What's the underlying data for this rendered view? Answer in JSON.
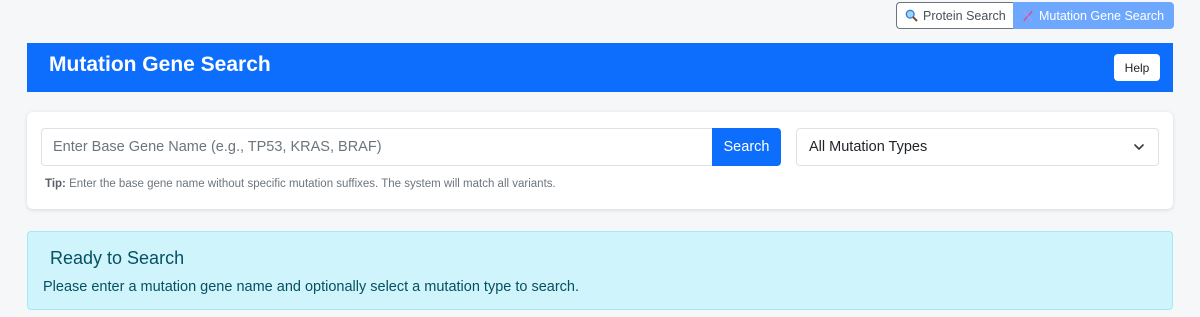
{
  "nav": {
    "protein_label": "Protein Search",
    "mutation_label": "Mutation Gene Search",
    "protein_icon": "magnifier-icon",
    "mutation_icon": "dna-icon"
  },
  "header": {
    "title": "Mutation Gene Search",
    "help_label": "Help"
  },
  "search": {
    "placeholder": "Enter Base Gene Name (e.g., TP53, KRAS, BRAF)",
    "value": "",
    "button_label": "Search",
    "tip_label": "Tip:",
    "tip_text": " Enter the base gene name without specific mutation suffixes. The system will match all variants."
  },
  "mutation_type": {
    "selected": "All Mutation Types"
  },
  "status": {
    "title": "Ready to Search",
    "message": "Please enter a mutation gene name and optionally select a mutation type to search."
  },
  "colors": {
    "primary": "#0d6efd",
    "active_toggle": "#6ea8fe",
    "info_bg": "#cff4fc",
    "info_text": "#055160"
  }
}
